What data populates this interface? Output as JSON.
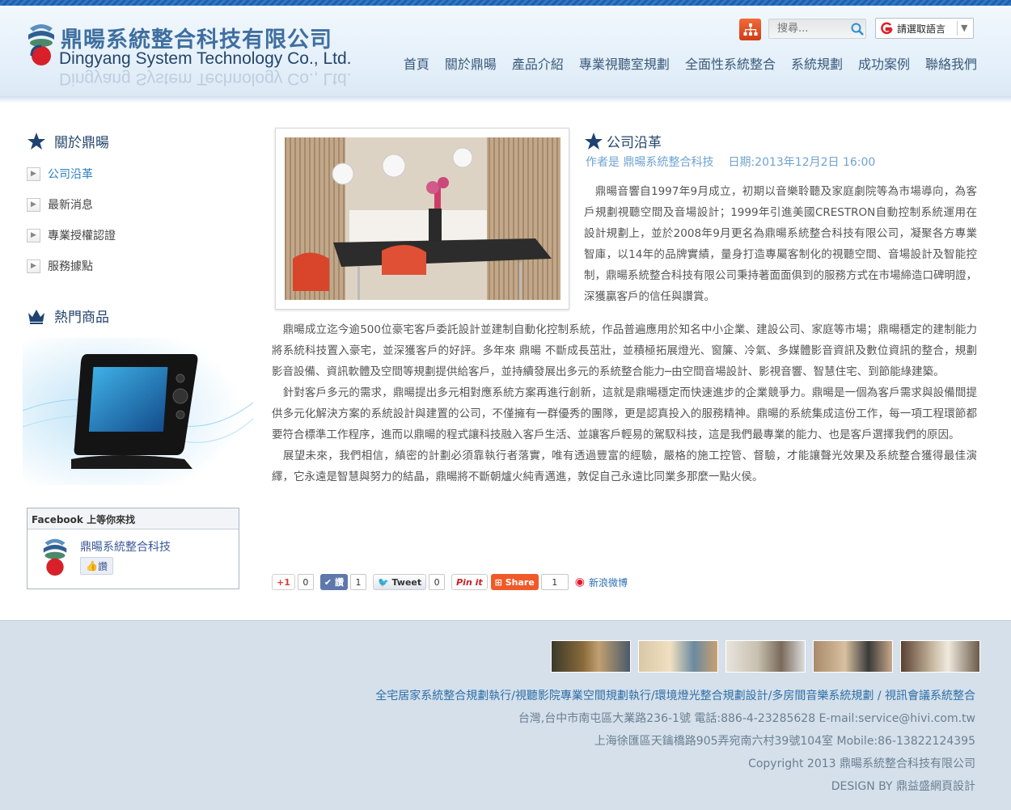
{
  "header": {
    "logo_cn": "鼎暘系統整合科技有限公司",
    "logo_en": "Dingyang System Technology Co., Ltd.",
    "search_placeholder": "搜尋...",
    "language_label": "請選取語言",
    "language_caret": "▼"
  },
  "nav": [
    "首頁",
    "關於鼎暘",
    "產品介紹",
    "專業視聽室規劃",
    "全面性系統整合",
    "系統規劃",
    "成功案例",
    "聯絡我們"
  ],
  "sidebar": {
    "about_title": "關於鼎暘",
    "items": [
      {
        "label": "公司沿革",
        "active": true
      },
      {
        "label": "最新消息",
        "active": false
      },
      {
        "label": "專業授權認證",
        "active": false
      },
      {
        "label": "服務據點",
        "active": false
      }
    ],
    "hot_title": "熱門商品",
    "facebook": {
      "header": "Facebook 上等你來找",
      "page_name": "鼎暘系統整合科技",
      "like_label": "讚"
    }
  },
  "article": {
    "title": "公司沿革",
    "author": "作者是 鼎暘系統整合科技",
    "date": "日期:2013年12月2日 16:00",
    "intro": "　鼎暘音響自1997年9月成立，初期以音樂聆聽及家庭劇院等為市場導向，為客戶規劃視聽空間及音場設計；1999年引進美國CRESTRON自動控制系統運用在設計規劃上，並於2008年9月更名為鼎暘系統整合科技有限公司，凝聚各方專業智庫，以14年的品牌實績，量身打造專屬客制化的視聽空間、音場設計及智能控制，鼎暘系統整合科技有限公司秉持著面面俱到的服務方式在市場締造口碑明證，深獲贏客戶的信任與讚賞。",
    "paragraphs": [
      "　鼎暘成立迄今逾500位豪宅客戶委託設計並建制自動化控制系統，作品普遍應用於知名中小企業、建設公司、家庭等市場；鼎暘穩定的建制能力將系統科技置入豪宅，並深獲客戶的好評。多年來 鼎暘 不斷成長茁壯，並積極拓展燈光、窗簾、冷氣、多媒體影音資訊及數位資訊的整合，規劃影音設備、資訊軟體及空間等規劃提供給客戶，並持續發展出多元的系統整合能力─由空間音場設計、影視音響、智慧住宅、到節能綠建築。",
      "　針對客戶多元的需求，鼎暘提出多元相對應系統方案再進行創新，這就是鼎暘穩定而快速進步的企業競爭力。鼎暘是一個為客戶需求與設備間提供多元化解決方案的系統設計與建置的公司，不僅擁有一群優秀的團隊，更是認真投入的服務精神。鼎暘的系統集成這份工作，每一項工程環節都要符合標準工作程序，進而以鼎暘的程式讓科技融入客戶生活、並讓客戶輕易的駕馭科技，這是我們最專業的能力、也是客戶選擇我們的原因。",
      "　展望未來，我們相信，縝密的計劃必須靠執行者落實，唯有透過豐富的經驗，嚴格的施工控管、督驗，才能讓聲光效果及系統整合獲得最佳演繹，它永遠是智慧與努力的結晶，鼎暘將不斷朝爐火純青邁進，敦促自己永遠比同業多那麼一點火侯。"
    ]
  },
  "share": {
    "gplus_label": "+1",
    "gplus_count": "0",
    "like_label": "讚",
    "like_count": "1",
    "tweet_label": "Tweet",
    "tweet_count": "0",
    "pin_label": "Pin it",
    "share_label": "Share",
    "share_count": "1",
    "weibo_label": "新浪微博"
  },
  "footer": {
    "links": [
      "全宅居家系統整合規劃執行",
      "視聽影院專業空間規劃執行",
      "環境燈光整合規劃設計",
      "多房間音樂系統規劃",
      "視訊會議系統整合"
    ],
    "address_tw": "台灣,台中市南屯區大業路236-1號 電話:886-4-23285628 E-mail:service@hivi.com.tw",
    "address_sh": "上海徐匯區天鑰橋路905弄宛南六村39號104室 Mobile:86-13822124395",
    "copyright": "Copyright 2013 鼎暘系統整合科技有限公司",
    "design": "DESIGN BY 鼎益盛網頁設計"
  },
  "colors": {
    "brand_blue": "#24456b",
    "accent_blue": "#2a7fc0",
    "footer_bg": "#d5e0ea"
  }
}
